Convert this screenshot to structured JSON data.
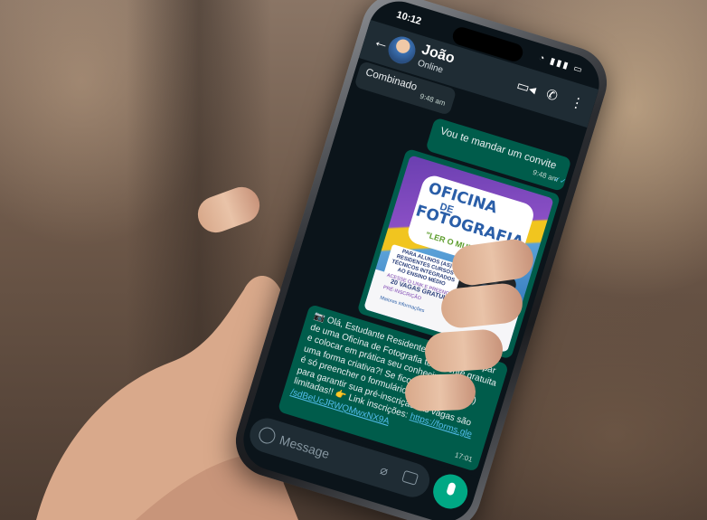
{
  "status": {
    "time": "10:12",
    "icons": "wifi signal battery"
  },
  "header": {
    "back": "←",
    "contact_name": "João",
    "presence": "Online"
  },
  "messages": [
    {
      "direction": "in",
      "text": "Combinado",
      "time": "9:48 am"
    },
    {
      "direction": "out",
      "text": "Vou te mandar um convite",
      "time": "9:48 am"
    },
    {
      "direction": "out",
      "type": "image",
      "time": "17:01"
    },
    {
      "direction": "out",
      "text_lines": [
        "📷 Olá, Estudante Residente! Deseja participar",
        "de uma Oficina de Fotografia totalmente gratuita",
        "e colocar em prática seu conhecimento de",
        "uma forma criativa?! Se ficou interessado (a)",
        "é só preencher o formulário online abaixo",
        "para garantir sua pré-inscrição! As vagas são",
        "limitadas!! 👉 Link inscrições: "
      ],
      "link": "https://forms.gle/sdBeUcJRWQMwxNX9A",
      "link_display": "https://forms.gle /sdBeUcJRWQMwxNX9A",
      "time": "17:01"
    }
  ],
  "flyer": {
    "line1": "OFICINA",
    "line2": "DE",
    "line3": "FOTOGRAFIA",
    "line4": "\"LER O MUNDO\"",
    "box_text": "PARA ALUNOS (AS) RESIDENTES CURSOS TÉCNICOS INTEGRADOS AO ENSINO MÉDIO",
    "vagas": "20 VAGAS GRATUITAS",
    "acesse": "ACESSE O LINK E PREENCHA O FORMULÁRIO PARA SUA PRÉ-INSCRIÇÃO",
    "info": "Maiores informações"
  },
  "composer": {
    "placeholder": "Message"
  },
  "colors": {
    "header": "#1f2c34",
    "outgoing": "#005c4b",
    "incoming": "#202c33",
    "accent": "#00a884",
    "link": "#53bdeb"
  },
  "icons": [
    "back-arrow-icon",
    "video-call-icon",
    "phone-icon",
    "more-icon",
    "emoji-icon",
    "attach-icon",
    "camera-icon",
    "mic-icon",
    "double-check-icon"
  ]
}
